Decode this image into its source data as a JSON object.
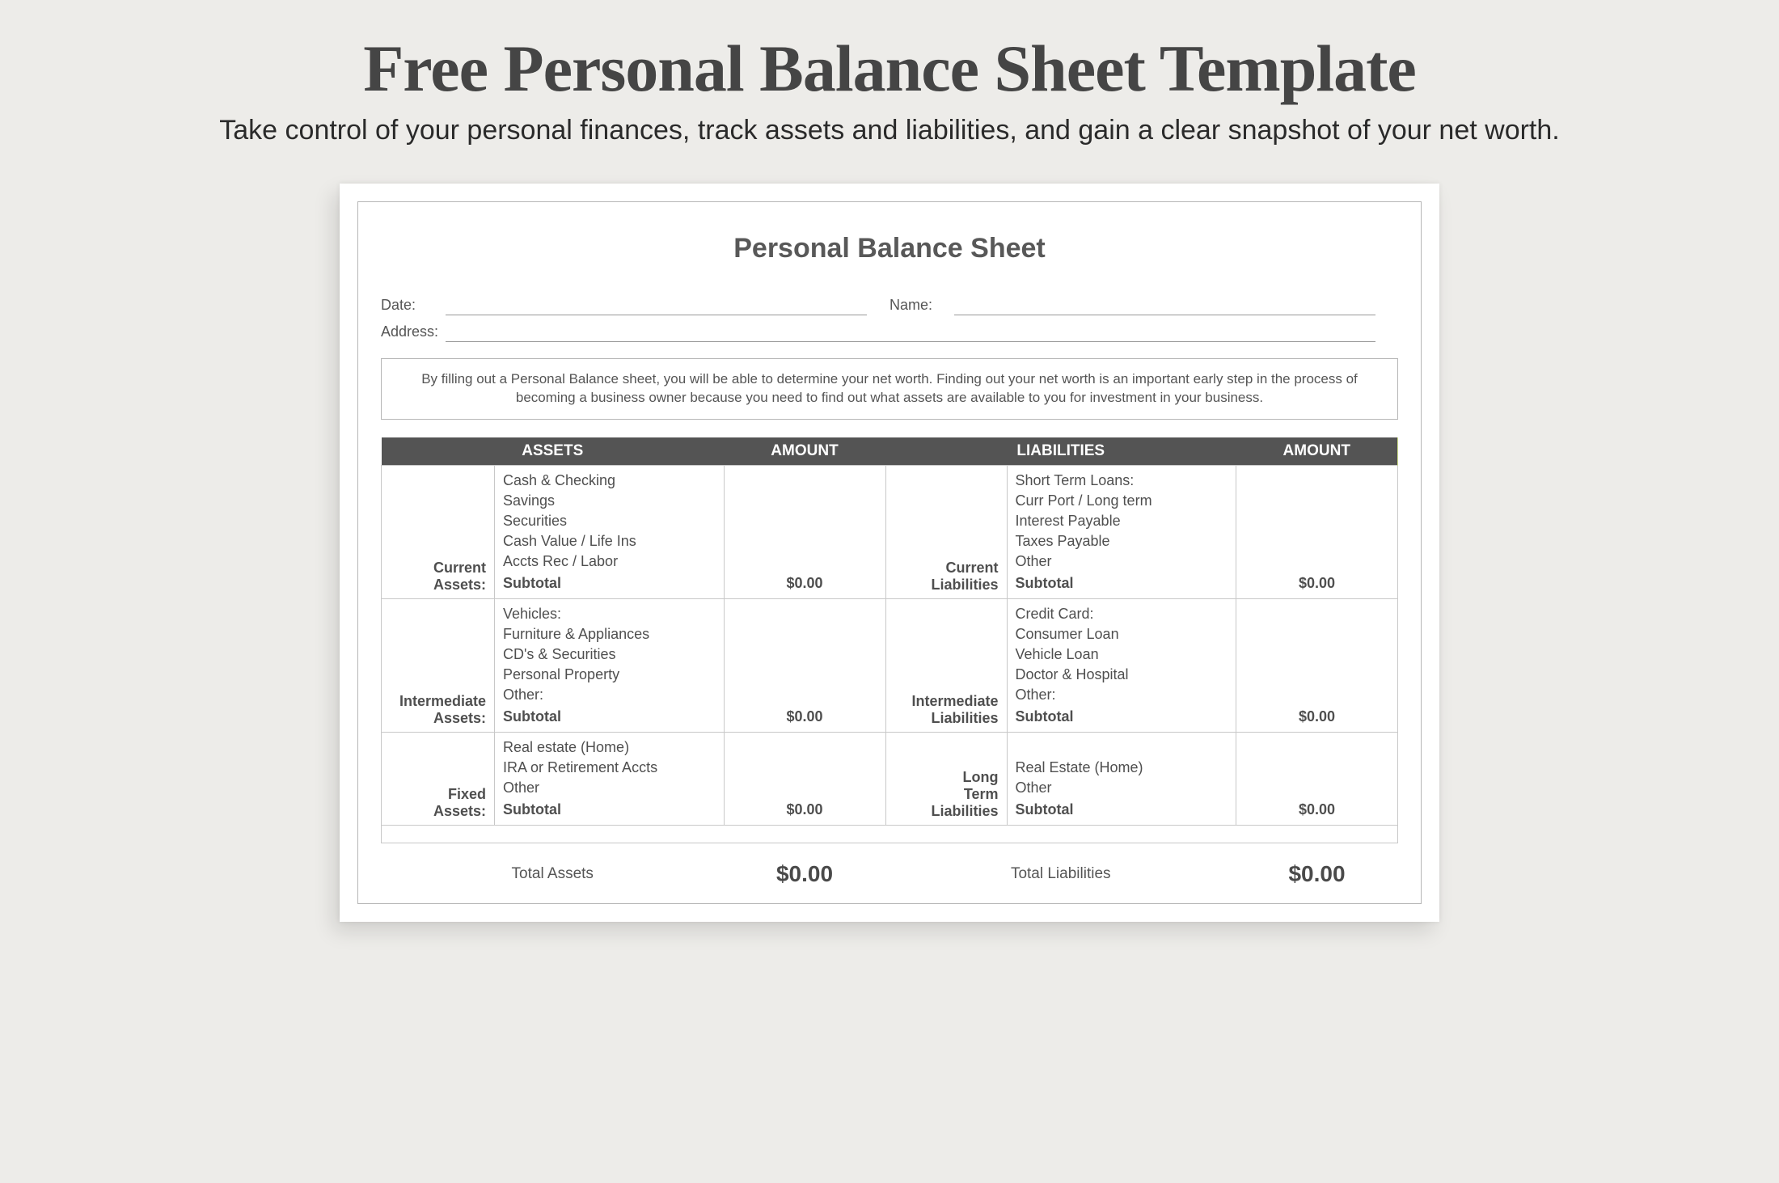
{
  "header": {
    "title": "Free Personal Balance Sheet Template",
    "subtitle": "Take control of your personal finances, track assets and liabilities, and gain a clear snapshot of your net worth."
  },
  "sheet": {
    "title": "Personal Balance Sheet",
    "meta": {
      "date_label": "Date:",
      "name_label": "Name:",
      "address_label": "Address:"
    },
    "intro": "By filling out a Personal Balance sheet, you will be able to determine your net worth. Finding out your net worth is an important early step in the process of becoming a business owner because you need to find out what assets are available to you for investment in your business.",
    "columns": {
      "assets": "ASSETS",
      "amount1": "AMOUNT",
      "liabilities": "LIABILITIES",
      "amount2": "AMOUNT"
    },
    "sections": [
      {
        "asset_cat": "Current Assets:",
        "assets": [
          "Cash & Checking",
          "Savings",
          "Securities",
          "Cash Value / Life Ins",
          "Accts Rec / Labor"
        ],
        "asset_subtotal_label": "Subtotal",
        "asset_subtotal": "$0.00",
        "liab_cat": "Current Liabilities",
        "liabs": [
          "Short Term Loans:",
          "Curr Port / Long term",
          "Interest Payable",
          "Taxes Payable",
          "Other"
        ],
        "liab_subtotal_label": "Subtotal",
        "liab_subtotal": "$0.00"
      },
      {
        "asset_cat": "Intermediate Assets:",
        "assets": [
          "Vehicles:",
          "Furniture & Appliances",
          "CD's & Securities",
          "Personal Property",
          "Other:"
        ],
        "asset_subtotal_label": "Subtotal",
        "asset_subtotal": "$0.00",
        "liab_cat": "Intermediate Liabilities",
        "liabs": [
          "Credit  Card:",
          "Consumer Loan",
          "Vehicle Loan",
          "Doctor & Hospital",
          "Other:"
        ],
        "liab_subtotal_label": "Subtotal",
        "liab_subtotal": "$0.00"
      },
      {
        "asset_cat": "Fixed Assets:",
        "assets": [
          "Real estate (Home)",
          "IRA or Retirement Accts",
          "Other"
        ],
        "asset_subtotal_label": "Subtotal",
        "asset_subtotal": "$0.00",
        "liab_cat": "Long Term Liabilities",
        "liabs": [
          "Real Estate (Home)",
          "Other"
        ],
        "liab_subtotal_label": "Subtotal",
        "liab_subtotal": "$0.00"
      }
    ],
    "totals": {
      "assets_label": "Total Assets",
      "assets_value": "$0.00",
      "liab_label": "Total Liabilities",
      "liab_value": "$0.00"
    }
  }
}
